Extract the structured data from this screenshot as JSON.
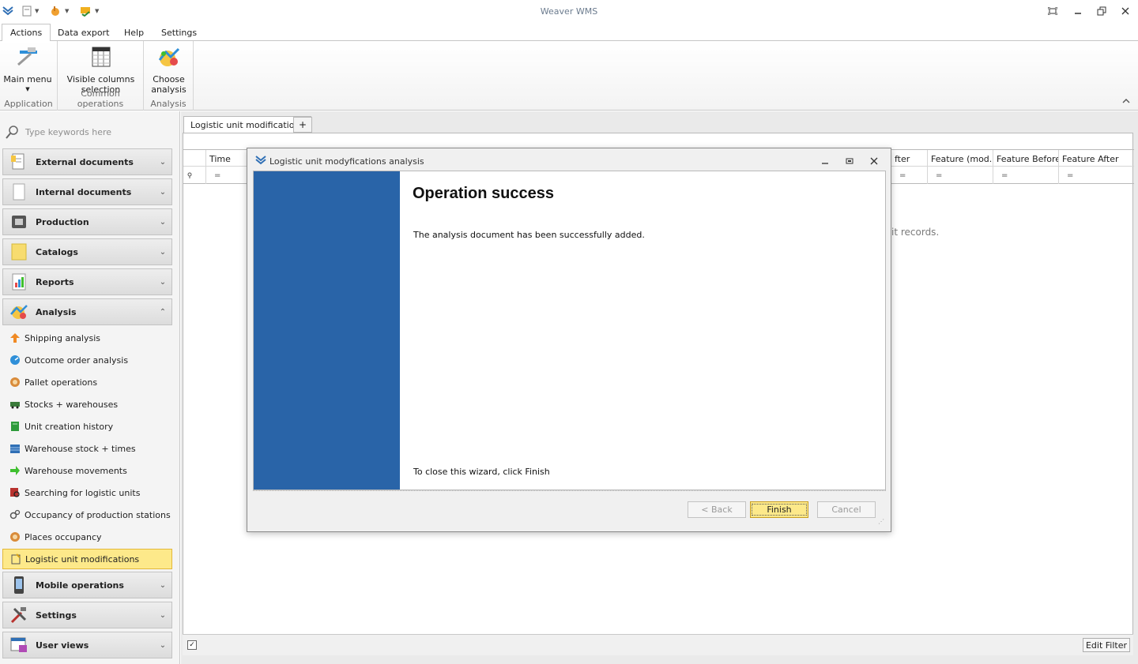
{
  "app": {
    "title": "Weaver WMS"
  },
  "menu": {
    "tabs": [
      "Actions",
      "Data export",
      "Help",
      "Settings"
    ],
    "active": "Actions"
  },
  "ribbon": {
    "groups": [
      {
        "label": "Application",
        "buttons": [
          {
            "label": "Main menu",
            "icon": "main-menu-icon"
          }
        ]
      },
      {
        "label": "Common operations",
        "buttons": [
          {
            "label_line1": "Visible columns",
            "label_line2": "selection",
            "icon": "columns-icon"
          }
        ]
      },
      {
        "label": "Analysis",
        "buttons": [
          {
            "label_line1": "Choose",
            "label_line2": "analysis",
            "icon": "analysis-icon"
          }
        ]
      }
    ]
  },
  "sidebar": {
    "search_placeholder": "Type keywords here",
    "groups": [
      {
        "label": "External documents",
        "icon": "external-documents-icon",
        "expanded": false
      },
      {
        "label": "Internal documents",
        "icon": "internal-documents-icon",
        "expanded": false
      },
      {
        "label": "Production",
        "icon": "production-icon",
        "expanded": false
      },
      {
        "label": "Catalogs",
        "icon": "catalogs-icon",
        "expanded": false
      },
      {
        "label": "Reports",
        "icon": "reports-icon",
        "expanded": false
      },
      {
        "label": "Analysis",
        "icon": "analysis-icon",
        "expanded": true
      },
      {
        "label": "Mobile operations",
        "icon": "mobile-icon",
        "expanded": false
      },
      {
        "label": "Settings",
        "icon": "settings-tools-icon",
        "expanded": false
      },
      {
        "label": "User views",
        "icon": "user-views-icon",
        "expanded": false
      }
    ],
    "analysis_items": [
      {
        "label": "Shipping analysis",
        "icon": "arrow-up-icon",
        "color": "#f08a24"
      },
      {
        "label": "Outcome order analysis",
        "icon": "gauge-icon",
        "color": "#2f8fd8"
      },
      {
        "label": "Pallet operations",
        "icon": "pallet-icon",
        "color": "#d98b3a"
      },
      {
        "label": "Stocks + warehouses",
        "icon": "truck-icon",
        "color": "#3a7a3a"
      },
      {
        "label": "Unit creation history",
        "icon": "book-icon",
        "color": "#2e9b3b"
      },
      {
        "label": "Warehouse stock + times",
        "icon": "warehouse-icon",
        "color": "#2f6fb5"
      },
      {
        "label": "Warehouse movements",
        "icon": "arrow-right-icon",
        "color": "#3fbf2f"
      },
      {
        "label": "Searching for logistic units",
        "icon": "search-units-icon",
        "color": "#b8322e"
      },
      {
        "label": "Occupancy of production stations",
        "icon": "gears-icon",
        "color": "#555555"
      },
      {
        "label": "Places occupancy",
        "icon": "places-icon",
        "color": "#d98b3a"
      },
      {
        "label": "Logistic unit modifications",
        "icon": "modifications-icon",
        "color": "#d4a017",
        "selected": true
      }
    ]
  },
  "document": {
    "tab_label": "Logistic unit modifications",
    "add_tab": "+",
    "columns": [
      "Time",
      "fter",
      "Feature (mod...",
      "Feature Before",
      "Feature After"
    ],
    "filter_symbol": "=",
    "empty_text": "it records.",
    "footer": {
      "edit_filter": "Edit Filter",
      "check": "✓"
    }
  },
  "modal": {
    "title": "Logistic unit modyfications analysis",
    "heading": "Operation success",
    "message": "The analysis document has been successfully added.",
    "close_hint": "To close this wizard, click Finish",
    "buttons": {
      "back": "< Back",
      "finish": "Finish",
      "cancel": "Cancel"
    }
  },
  "colors": {
    "wizard_side": "#2964a8",
    "selection": "#fde98a",
    "accent": "#2f6fb5"
  }
}
